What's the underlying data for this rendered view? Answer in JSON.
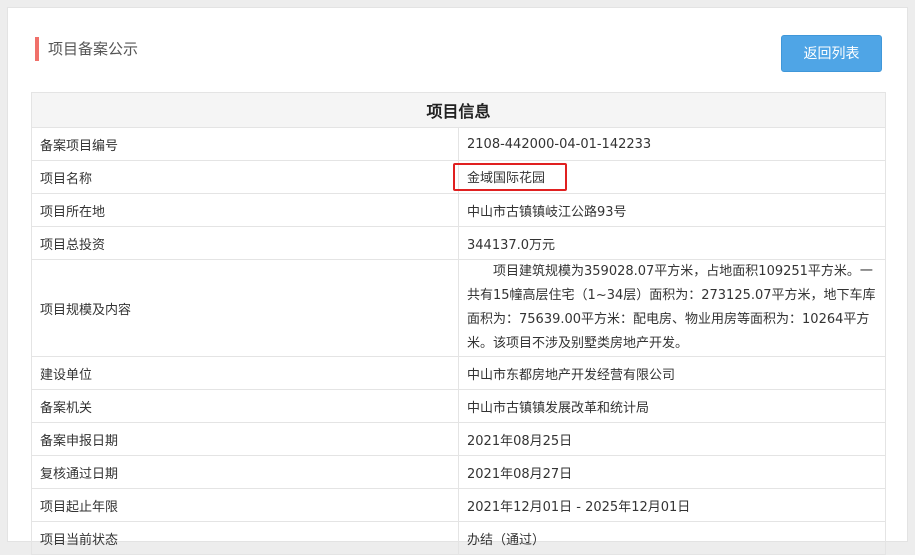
{
  "header": {
    "title": "项目备案公示",
    "back_button": "返回列表"
  },
  "table": {
    "heading": "项目信息",
    "rows": [
      {
        "label": "备案项目编号",
        "value": "2108-442000-04-01-142233"
      },
      {
        "label": "项目名称",
        "value": "金域国际花园"
      },
      {
        "label": "项目所在地",
        "value": "中山市古镇镇岐江公路93号"
      },
      {
        "label": "项目总投资",
        "value": "344137.0万元"
      },
      {
        "label": "项目规模及内容",
        "value": "　　项目建筑规模为359028.07平方米，占地面积109251平方米。一共有15幢高层住宅（1~34层）面积为：273125.07平方米，地下车库面积为：75639.00平方米：配电房、物业用房等面积为：10264平方米。该项目不涉及别墅类房地产开发。"
      },
      {
        "label": "建设单位",
        "value": "中山市东都房地产开发经营有限公司"
      },
      {
        "label": "备案机关",
        "value": "中山市古镇镇发展改革和统计局"
      },
      {
        "label": "备案申报日期",
        "value": "2021年08月25日"
      },
      {
        "label": "复核通过日期",
        "value": "2021年08月27日"
      },
      {
        "label": "项目起止年限",
        "value": "2021年12月01日 - 2025年12月01日"
      },
      {
        "label": "项目当前状态",
        "value": "办结（通过）"
      }
    ]
  },
  "colors": {
    "accent_bar": "#f0706a",
    "button": "#4fa5e6",
    "highlight_box": "#e02020"
  }
}
